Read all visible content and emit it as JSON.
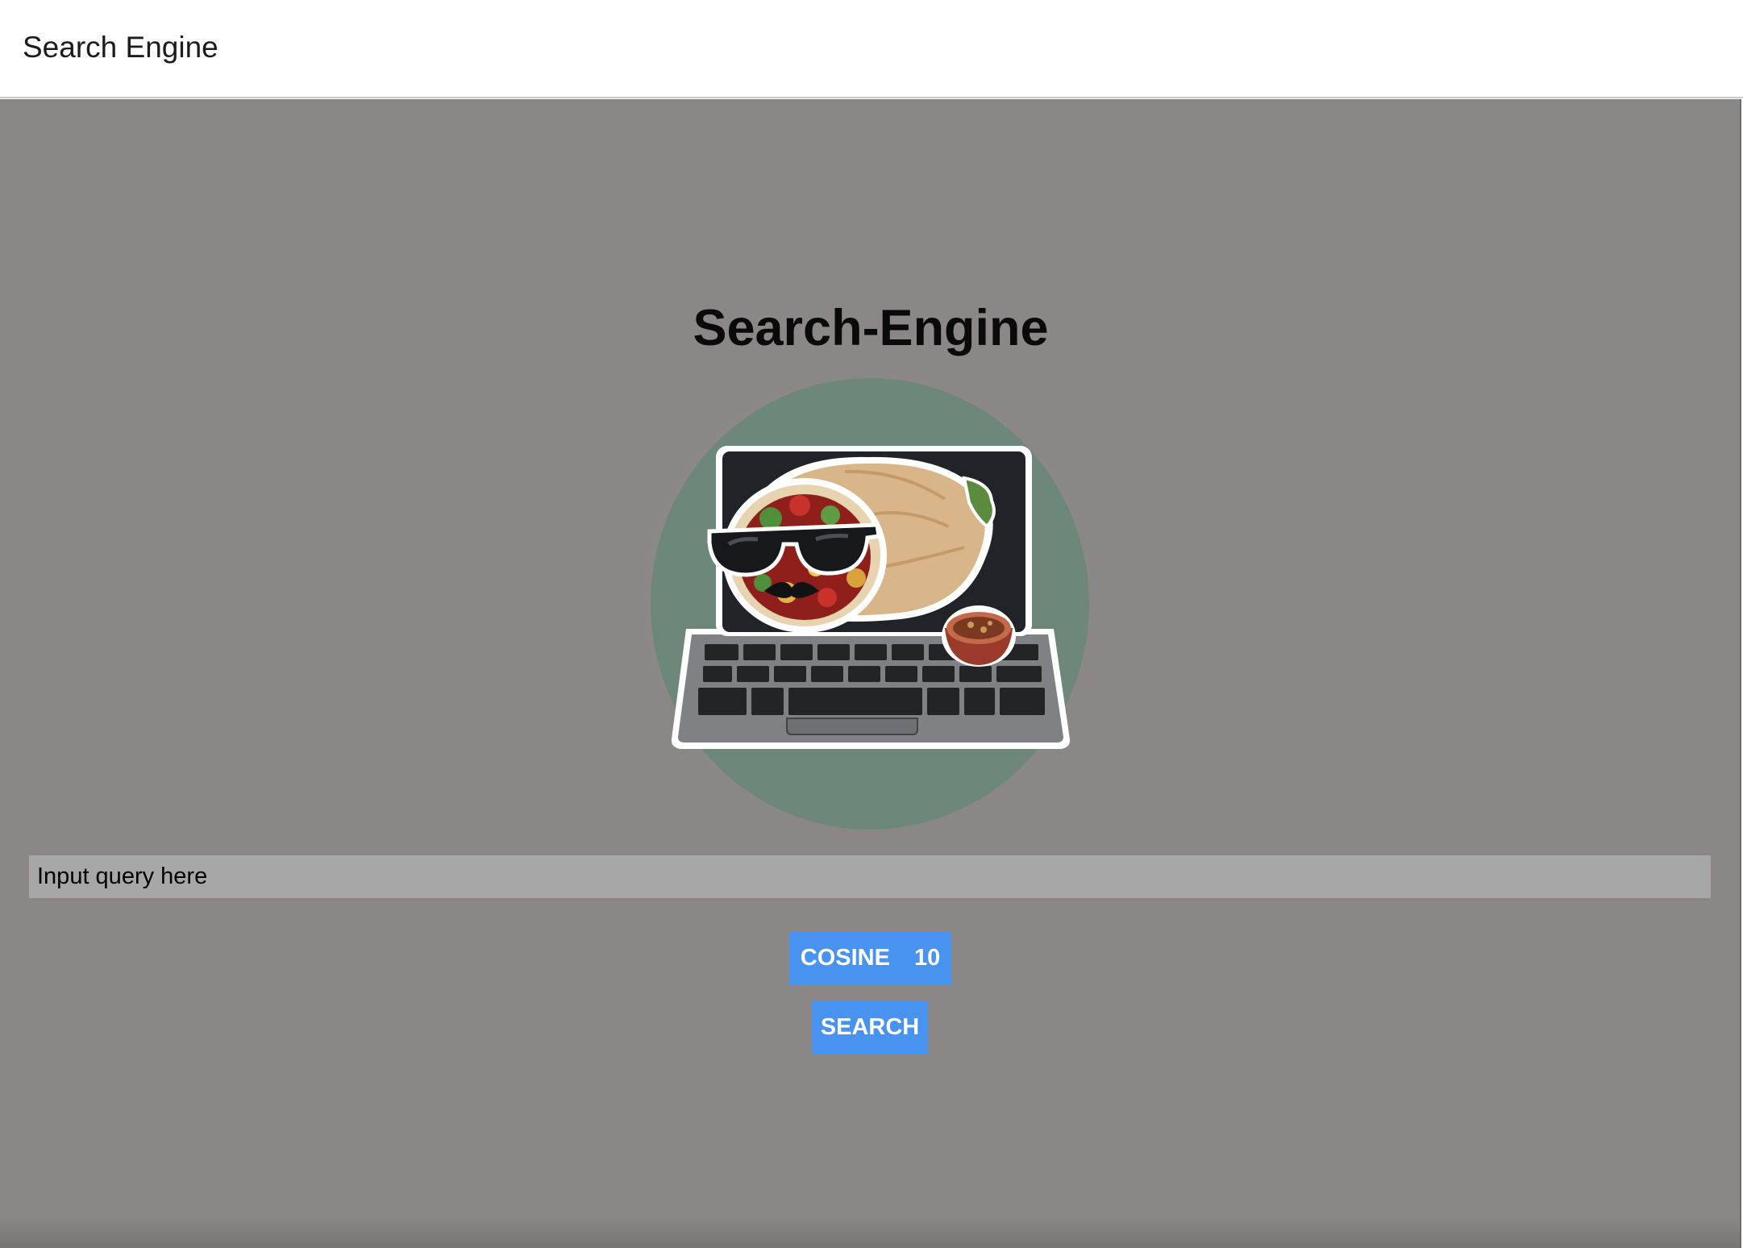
{
  "header": {
    "title": "Search Engine"
  },
  "main": {
    "heading": "Search-Engine",
    "logo": {
      "icon": "burrito-laptop-logo",
      "circle_color": "#6d8778"
    },
    "search": {
      "placeholder": "Input query here",
      "value": ""
    },
    "options_button": {
      "metric": "COSINE",
      "count": "10"
    },
    "search_button": {
      "label": "SEARCH"
    }
  },
  "colors": {
    "background": "#8b8786",
    "topbar": "#ffffff",
    "accent": "#4893ef",
    "input_background": "#a7a7a7"
  }
}
